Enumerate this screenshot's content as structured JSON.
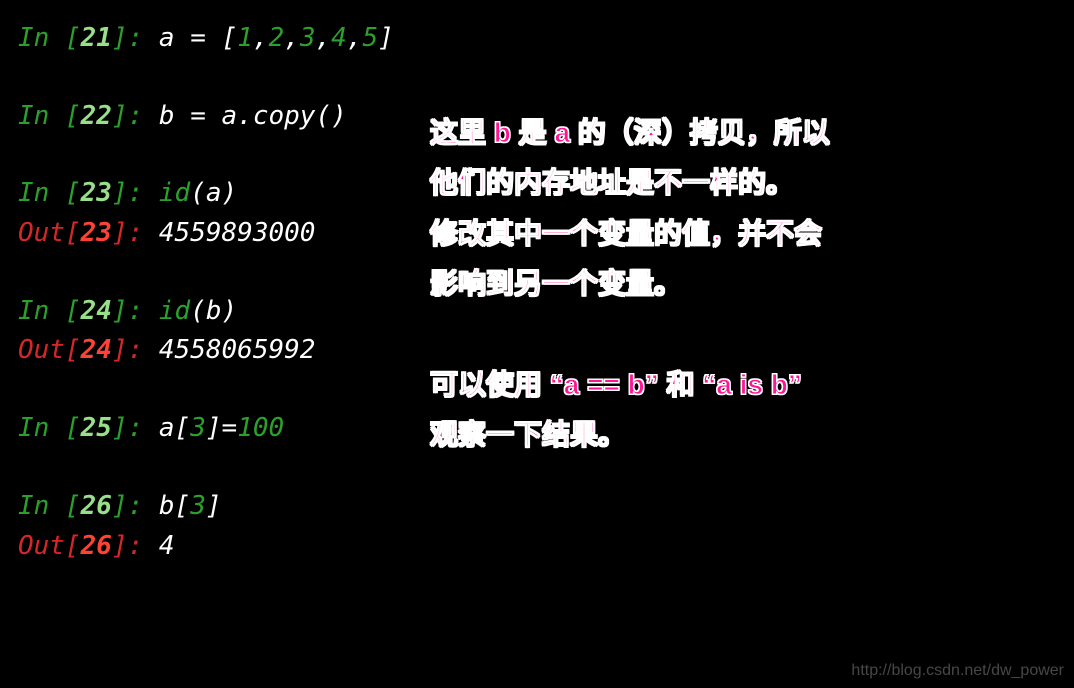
{
  "cells": {
    "c21": {
      "in_prefix": "In [",
      "num": "21",
      "in_suffix": "]: ",
      "code_pre": "a = [",
      "n1": "1",
      "n2": "2",
      "n3": "3",
      "n4": "4",
      "n5": "5",
      "comma": ",",
      "code_post": "]"
    },
    "c22": {
      "in_prefix": "In [",
      "num": "22",
      "in_suffix": "]: ",
      "code": "b = a.copy()"
    },
    "c23": {
      "in_prefix": "In [",
      "num": "23",
      "in_suffix": "]: ",
      "builtin": "id",
      "arg": "(a)",
      "out_prefix": "Out[",
      "out_num": "23",
      "out_suffix": "]: ",
      "output": "4559893000"
    },
    "c24": {
      "in_prefix": "In [",
      "num": "24",
      "in_suffix": "]: ",
      "builtin": "id",
      "arg": "(b)",
      "out_prefix": "Out[",
      "out_num": "24",
      "out_suffix": "]: ",
      "output": "4558065992"
    },
    "c25": {
      "in_prefix": "In [",
      "num": "25",
      "in_suffix": "]: ",
      "code_pre": "a[",
      "idx": "3",
      "code_mid": "]=",
      "val": "100"
    },
    "c26": {
      "in_prefix": "In [",
      "num": "26",
      "in_suffix": "]: ",
      "code_pre": "b[",
      "idx": "3",
      "code_post": "]",
      "out_prefix": "Out[",
      "out_num": "26",
      "out_suffix": "]: ",
      "output": "4"
    }
  },
  "annotation": {
    "line1": "这里 b 是 a 的（深）拷贝，所以",
    "line2": "他们的内存地址是不一样的。",
    "line3": "修改其中一个变量的值，并不会",
    "line4": "影响到另一个变量。",
    "line5": "可以使用 “a == b” 和 “a is b”",
    "line6": "观察一下结果。"
  },
  "watermark": "http://blog.csdn.net/dw_power"
}
